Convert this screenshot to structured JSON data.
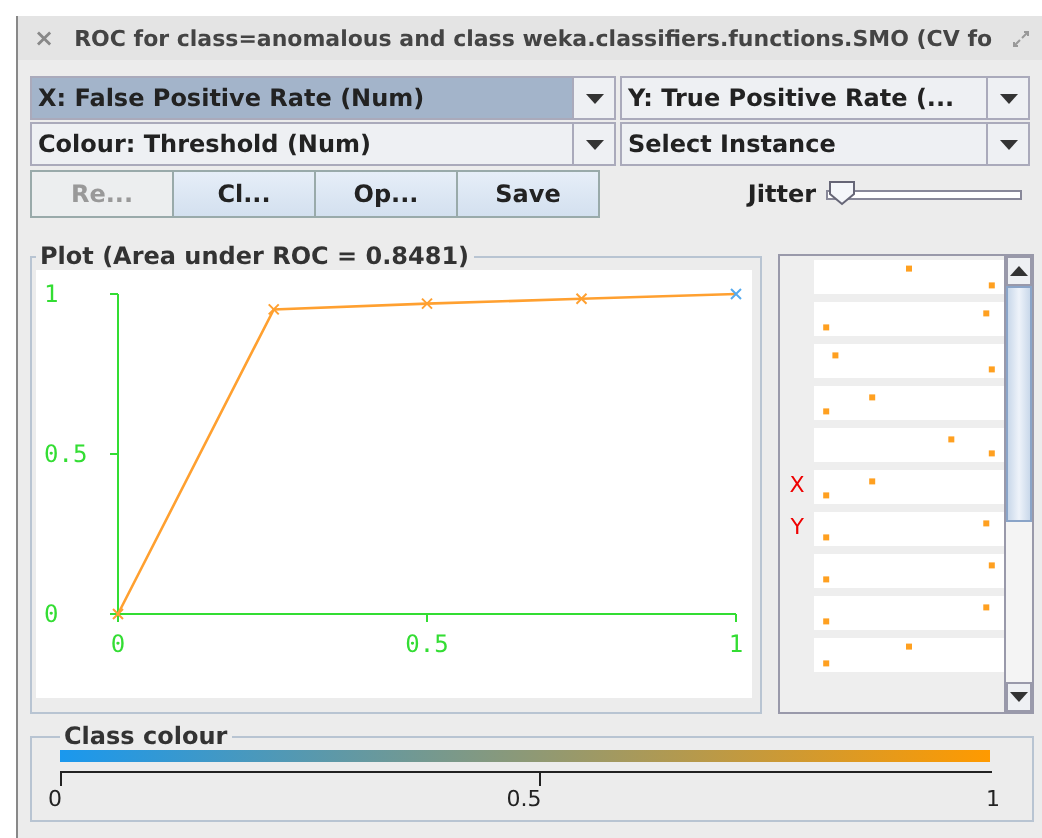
{
  "window": {
    "title": "ROC for class=anomalous and class weka.classifiers.functions.SMO (CV fo",
    "close": "×"
  },
  "selectors": [
    {
      "label": "X: False Positive Rate (Num)",
      "selected": true
    },
    {
      "label": "Y: True Positive Rate (...",
      "selected": false
    },
    {
      "label": "Colour: Threshold (Num)",
      "selected": false
    },
    {
      "label": "Select Instance",
      "selected": false
    }
  ],
  "buttons": [
    {
      "label": "Re...",
      "disabled": true
    },
    {
      "label": "Cl...",
      "disabled": false
    },
    {
      "label": "Op...",
      "disabled": false
    },
    {
      "label": "Save",
      "disabled": false
    }
  ],
  "jitter": {
    "label": "Jitter",
    "level": 0
  },
  "plot": {
    "title": "Plot (Area under ROC = 0.8481)",
    "chart_data": {
      "type": "line",
      "x": [
        0,
        0.252,
        0.5,
        0.75,
        1
      ],
      "series": [
        {
          "marker": "x",
          "color": "#ffa030",
          "values": [
            0,
            0.952,
            0.97,
            0.985,
            1
          ]
        }
      ],
      "xlim": [
        0,
        1
      ],
      "ylim": [
        0,
        1
      ],
      "xticks": [
        0,
        0.5,
        1
      ],
      "yticks": [
        0,
        0.5,
        1
      ]
    }
  },
  "matrix": {
    "x_label": "X",
    "y_label": "Y"
  },
  "class_colour": {
    "title": "Class colour",
    "ticks": [
      "0",
      "0.5",
      "1"
    ]
  }
}
